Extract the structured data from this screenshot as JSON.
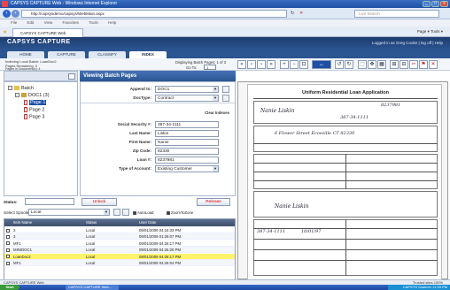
{
  "window": {
    "title": "CAPSYS CAPTURE Web - Windows Internet Explorer"
  },
  "browser": {
    "url": "http://capsysdemo/capsys/WebMain.aspx",
    "search_placeholder": "Live Search",
    "menu": [
      "File",
      "Edit",
      "View",
      "Favorites",
      "Tools",
      "Help"
    ],
    "tab_label": "CAPSYS CAPTURE Web",
    "command_bar": "Page ▾  Tools ▾"
  },
  "app": {
    "brand": "CAPSYS CAPTURE",
    "user_text": "Logged in as Greg Cooke | log off | Help",
    "tabs": [
      "HOME",
      "CAPTURE",
      "CLASSIFY",
      "INDEX"
    ],
    "active_tab": "INDEX"
  },
  "info": {
    "batch_line": "Indexing Local Batch: LoanDoc2",
    "pages_remaining": "Pages Remaining: 3",
    "pages_in_docs": "Pages in Document(s): 4",
    "displaying": "Displaying Batch Pages: 1 of 3",
    "goto_label": "Go To:",
    "goto_value": "1"
  },
  "tree": {
    "batch": "Batch",
    "doc": "DOC1 (3)",
    "pages": [
      "Page 1",
      "Page 2",
      "Page 3"
    ]
  },
  "panel": {
    "title": "Viewing Batch Pages"
  },
  "form": {
    "append_to_label": "Append to:",
    "append_to_value": "DOC1",
    "doctype_label": "DocType:",
    "doctype_value": "Contract",
    "clear_label": "Clear Indexes",
    "fields": [
      {
        "label": "Social Security #:",
        "value": "387-34-1111"
      },
      {
        "label": "Last Name:",
        "value": "Liskin"
      },
      {
        "label": "First Name:",
        "value": "Nanie"
      },
      {
        "label": "Zip Code:",
        "value": "82330"
      },
      {
        "label": "Loan #:",
        "value": "8237981"
      }
    ],
    "account_label": "Type of Account:",
    "account_value": "Existing Customer"
  },
  "actions": {
    "unlock": "Unlock",
    "release": "Release"
  },
  "status": {
    "label": "Status:"
  },
  "spool": {
    "label": "Select Spooler:",
    "value": "Local",
    "autoload": "AutoLoad",
    "zoomfit": "ZoomToZone"
  },
  "grid": {
    "headers": [
      "Item Name",
      "Status",
      "User Date"
    ],
    "rows": [
      {
        "name": "3",
        "status": "Local",
        "date": "09/01/2009 04:16:33 PM"
      },
      {
        "name": "3",
        "status": "Local",
        "date": "09/01/2009 01:26:07 PM"
      },
      {
        "name": "MF1",
        "status": "Local",
        "date": "09/01/2009 04:26:17 PM"
      },
      {
        "name": "MINIDOC1",
        "status": "Local",
        "date": "09/01/2009 04:26:25 PM"
      },
      {
        "name": "LoanDoc2",
        "status": "Local",
        "date": "09/01/2009 04:26:17 PM"
      },
      {
        "name": "MF1",
        "status": "Local",
        "date": "09/01/2009 04:26:04 PM"
      }
    ],
    "highlight_index": 4
  },
  "document": {
    "title": "Uniform Residential Loan Application",
    "sig_name": "Nanie Liskin",
    "hand_ssn": "387-34-1111",
    "hand_loan": "8237981",
    "hand_address": "6 Flower Street  Ecosville  CT  82330",
    "hand_date": "10/01/97"
  },
  "statusbar": {
    "left": "CAPSYS CAPTURE Web",
    "right": "Trusted sites   100%"
  },
  "taskbar": {
    "start": "Start",
    "task1": "CAPSYS CAPTURE Web...",
    "tray": "CAPSYS Scanner   11:33 PM"
  },
  "colors": {
    "brand_blue": "#2b5591",
    "highlight": "#fff36b",
    "button_text": "#cc0000"
  }
}
